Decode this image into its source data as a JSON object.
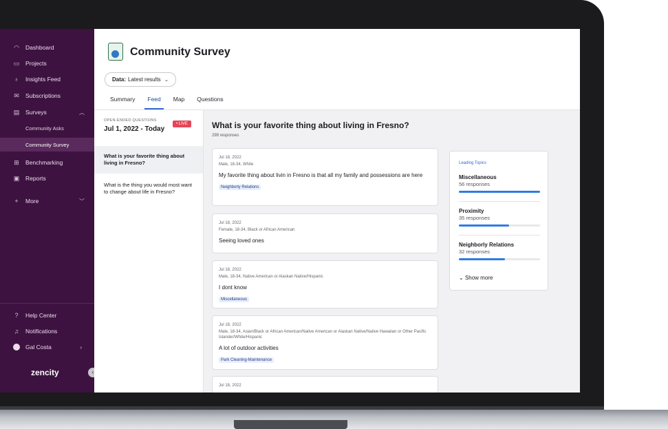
{
  "sidebar": {
    "nav": [
      {
        "label": "Dashboard",
        "icon": "dashboard-icon"
      },
      {
        "label": "Projects",
        "icon": "folder-icon"
      },
      {
        "label": "Insights Feed",
        "icon": "lightbulb-icon"
      },
      {
        "label": "Subscriptions",
        "icon": "mail-icon"
      },
      {
        "label": "Surveys",
        "icon": "clipboard-icon"
      }
    ],
    "survey_sub": [
      "Community Asks",
      "Community Survey"
    ],
    "nav2": [
      {
        "label": "Benchmarking",
        "icon": "benchmark-icon"
      },
      {
        "label": "Reports",
        "icon": "report-icon"
      },
      {
        "label": "More",
        "icon": "plus-icon"
      }
    ],
    "bottom": [
      {
        "label": "Help Center",
        "icon": "help-icon"
      },
      {
        "label": "Notifications",
        "icon": "bell-icon"
      },
      {
        "label": "Gal Costa",
        "icon": "user-avatar-icon"
      }
    ],
    "logo": "zencity"
  },
  "header": {
    "title": "Community Survey",
    "data_label": "Data:",
    "data_value": "Latest results",
    "tabs": [
      "Summary",
      "Feed",
      "Map",
      "Questions"
    ],
    "active_tab": "Feed"
  },
  "questions": {
    "section_label": "OPEN-ENDED QUESTIONS",
    "date_range": "Jul 1, 2022 - Today",
    "live_badge": "• LIVE",
    "items": [
      "What is your favorite thing about living in Fresno?",
      "What is the thing you would most want to change about life in Fresno?"
    ]
  },
  "feed": {
    "title": "What is your favorite thing about living in Fresno?",
    "count": "299 responses",
    "responses": [
      {
        "date": "Jul 18, 2022",
        "meta": "Male, 18-34, White",
        "text": "My favorite thing about livin in Fresno is that all my family and possessions are here",
        "tag": "Neighborly Relations"
      },
      {
        "date": "Jul 18, 2022",
        "meta": "Female, 18-34, Black or African American",
        "text": "Seeing loved ones",
        "tag": ""
      },
      {
        "date": "Jul 18, 2022",
        "meta": "Male, 18-34, Native American or Alaskan Native/Hispanic",
        "text": "I dont know",
        "tag": "Miscellaneous"
      },
      {
        "date": "Jul 18, 2022",
        "meta": "Male, 18-34, Asian/Black or African American/Native American or Alaskan Native/Native Hawaiian or Other Pacific Islander/White/Hispanic",
        "text": "A lot of outdoor activities",
        "tag": "Park Cleaning-Maintenance"
      },
      {
        "date": "Jul 18, 2022",
        "meta": "",
        "text": "",
        "tag": ""
      }
    ]
  },
  "topics": {
    "heading": "Leading Topics",
    "items": [
      {
        "name": "Miscellaneous",
        "count": "56 responses",
        "share": 1.0
      },
      {
        "name": "Proximity",
        "count": "35 responses",
        "share": 0.62
      },
      {
        "name": "Neighborly Relations",
        "count": "32 responses",
        "share": 0.57
      }
    ],
    "show_more": "Show more"
  }
}
